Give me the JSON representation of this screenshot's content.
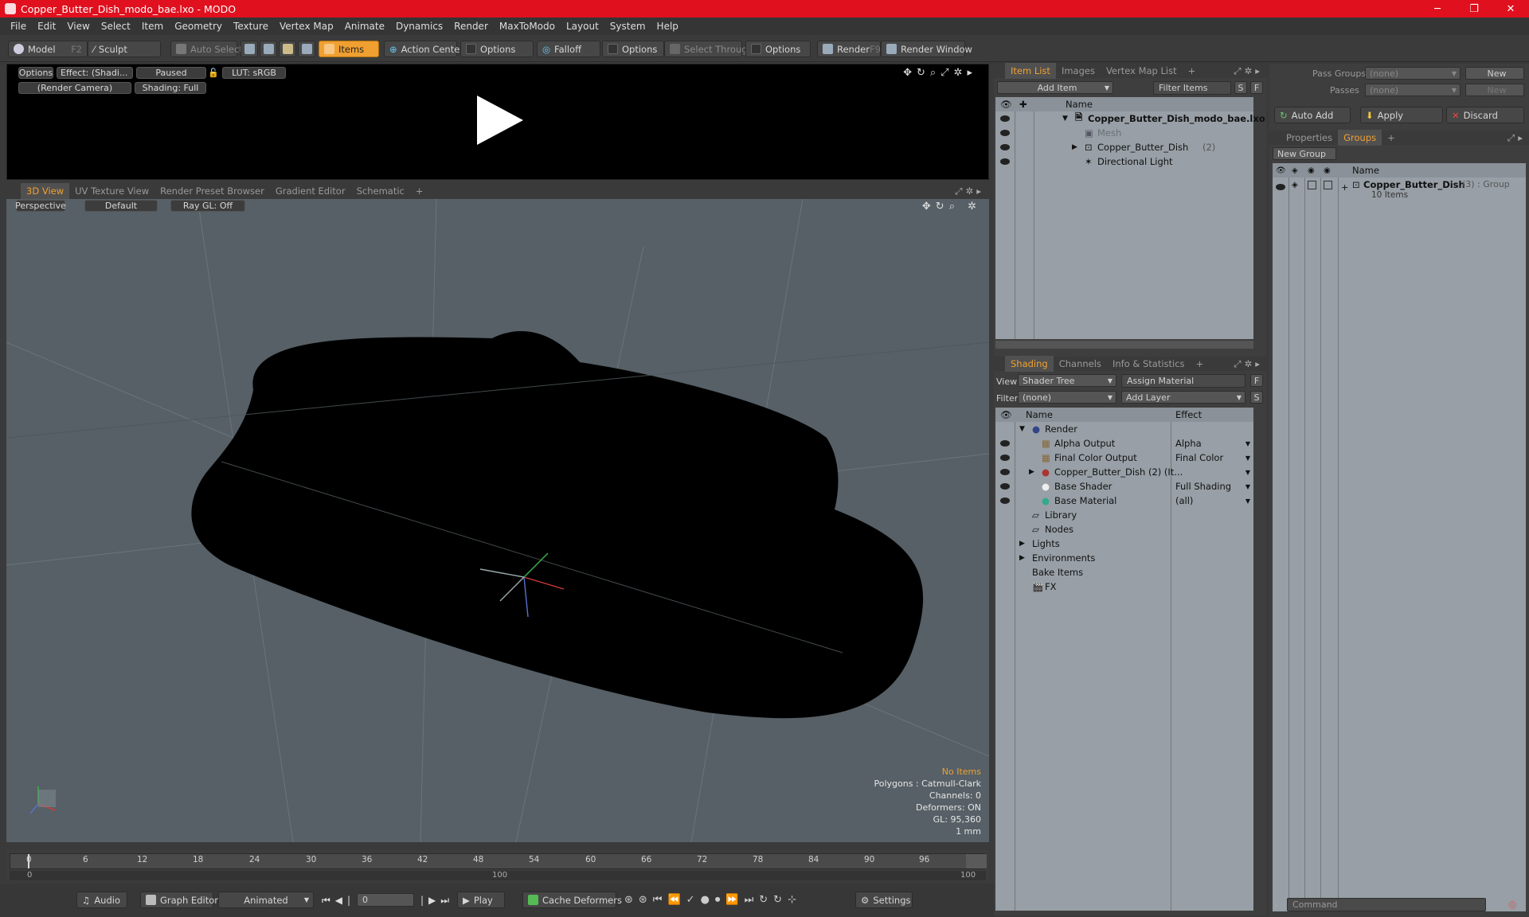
{
  "window": {
    "title": "Copper_Butter_Dish_modo_bae.lxo - MODO",
    "min": "─",
    "max": "❐",
    "close": "✕"
  },
  "menu": [
    "File",
    "Edit",
    "View",
    "Select",
    "Item",
    "Geometry",
    "Texture",
    "Vertex Map",
    "Animate",
    "Dynamics",
    "Render",
    "MaxToModo",
    "Layout",
    "System",
    "Help"
  ],
  "toolbar": {
    "model": "Model",
    "model_key": "F2",
    "sculpt": "Sculpt",
    "auto_select": "Auto Select",
    "items": "Items",
    "action_center": "Action Center",
    "options1": "Options",
    "falloff": "Falloff",
    "options2": "Options",
    "select_through": "Select Through",
    "options3": "Options",
    "render": "Render",
    "render_key": "F9",
    "render_window": "Render Window"
  },
  "preview": {
    "options": "Options",
    "effect": "Effect: (Shadi...",
    "paused": "Paused",
    "lut": "LUT: sRGB",
    "camera": "(Render Camera)",
    "shading": "Shading: Full"
  },
  "viewtabs": [
    "3D View",
    "UV Texture View",
    "Render Preset Browser",
    "Gradient Editor",
    "Schematic",
    "+"
  ],
  "viewport": {
    "perspective": "Perspective",
    "default": "Default",
    "raygl": "Ray GL: Off",
    "info": [
      "No Items",
      "Polygons : Catmull-Clark",
      "Channels: 0",
      "Deformers: ON",
      "GL: 95,360",
      "1 mm"
    ]
  },
  "timeline": {
    "ticks": [
      "0",
      "6",
      "12",
      "18",
      "24",
      "30",
      "36",
      "42",
      "48",
      "54",
      "60",
      "66",
      "72",
      "78",
      "84",
      "90",
      "96"
    ],
    "lower": [
      "0",
      "100",
      "100"
    ]
  },
  "bottom": {
    "audio": "Audio",
    "graph_editor": "Graph Editor",
    "animated": "Animated",
    "frame": "0",
    "play": "Play",
    "cache": "Cache Deformers",
    "settings": "Settings"
  },
  "itemlist": {
    "tabs": [
      "Item List",
      "Images",
      "Vertex Map List",
      "+"
    ],
    "add_item": "Add Item",
    "filter": "Filter Items",
    "s": "S",
    "f": "F",
    "col_name": "Name",
    "rows": [
      {
        "name": "Copper_Butter_Dish_modo_bae.lxo",
        "extra": ""
      },
      {
        "name": "Mesh",
        "extra": ""
      },
      {
        "name": "Copper_Butter_Dish",
        "extra": "(2)"
      },
      {
        "name": "Directional Light",
        "extra": ""
      }
    ]
  },
  "shading": {
    "tabs": [
      "Shading",
      "Channels",
      "Info & Statistics",
      "+"
    ],
    "view_label": "View",
    "view_value": "Shader Tree",
    "assign": "Assign Material",
    "filter_label": "Filter",
    "filter_value": "(none)",
    "add_layer": "Add Layer",
    "f": "F",
    "s": "S",
    "col_name": "Name",
    "col_effect": "Effect",
    "rows": [
      {
        "name": "Render",
        "effect": ""
      },
      {
        "name": "Alpha Output",
        "effect": "Alpha"
      },
      {
        "name": "Final Color Output",
        "effect": "Final Color"
      },
      {
        "name": "Copper_Butter_Dish (2) (It...",
        "effect": ""
      },
      {
        "name": "Base Shader",
        "effect": "Full Shading"
      },
      {
        "name": "Base Material",
        "effect": "(all)"
      },
      {
        "name": "Library",
        "effect": ""
      },
      {
        "name": "Nodes",
        "effect": ""
      },
      {
        "name": "Lights",
        "effect": ""
      },
      {
        "name": "Environments",
        "effect": ""
      },
      {
        "name": "Bake Items",
        "effect": ""
      },
      {
        "name": "FX",
        "effect": ""
      }
    ]
  },
  "groups": {
    "pass_groups": "Pass Groups",
    "passes": "Passes",
    "none": "(none)",
    "new": "New",
    "auto_add": "Auto Add",
    "apply": "Apply",
    "discard": "Discard",
    "tabs": [
      "Properties",
      "Groups",
      "+"
    ],
    "new_group": "New Group",
    "col_name": "Name",
    "group_name": "Copper_Butter_Dish",
    "group_extra": "(3) : Group",
    "group_items": "10 Items"
  },
  "command": {
    "placeholder": "Command"
  }
}
